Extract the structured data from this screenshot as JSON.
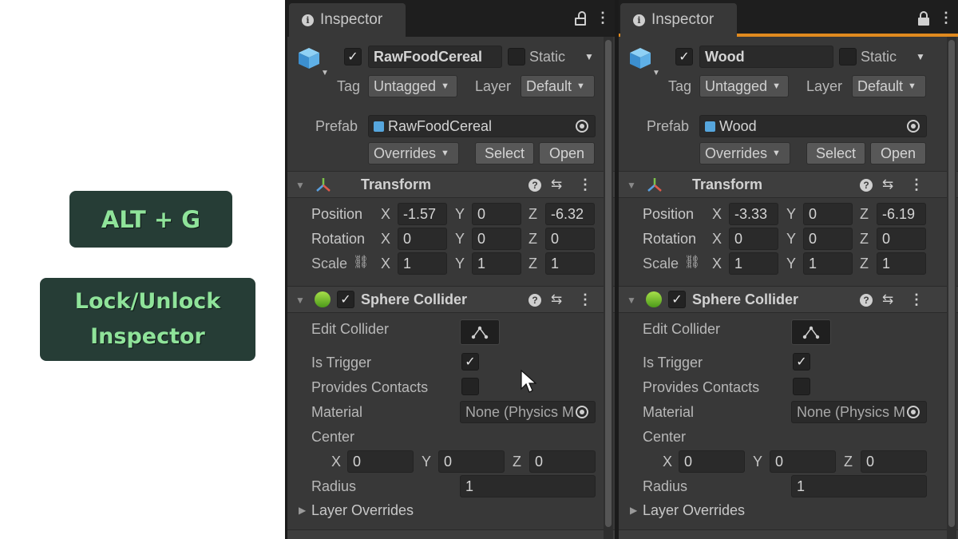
{
  "overlay": {
    "shortcut": "ALT + G",
    "description_line1": "Lock/Unlock",
    "description_line2": "Inspector"
  },
  "colors": {
    "badge_bg": "#263d36",
    "badge_text": "#8fe39a",
    "panel_bg": "#383838",
    "active_tab_accent": "#e08a1f"
  },
  "panels": [
    {
      "tab_label": "Inspector",
      "locked": false,
      "object_name": "RawFoodCereal",
      "enabled": true,
      "static_label": "Static",
      "tag_label": "Tag",
      "tag_value": "Untagged",
      "layer_label": "Layer",
      "layer_value": "Default",
      "prefab_label": "Prefab",
      "prefab_value": "RawFoodCereal",
      "overrides_label": "Overrides",
      "select_label": "Select",
      "open_label": "Open",
      "transform": {
        "title": "Transform",
        "position_label": "Position",
        "position": {
          "x": "-1.57",
          "y": "0",
          "z": "-6.32"
        },
        "rotation_label": "Rotation",
        "rotation": {
          "x": "0",
          "y": "0",
          "z": "0"
        },
        "scale_label": "Scale",
        "scale": {
          "x": "1",
          "y": "1",
          "z": "1"
        }
      },
      "sphere_collider": {
        "title": "Sphere Collider",
        "enabled": true,
        "edit_collider_label": "Edit Collider",
        "is_trigger_label": "Is Trigger",
        "is_trigger": true,
        "provides_contacts_label": "Provides Contacts",
        "provides_contacts": false,
        "material_label": "Material",
        "material_value": "None (Physics M",
        "center_label": "Center",
        "center": {
          "x": "0",
          "y": "0",
          "z": "0"
        },
        "radius_label": "Radius",
        "radius": "1",
        "layer_overrides_label": "Layer Overrides"
      }
    },
    {
      "tab_label": "Inspector",
      "locked": true,
      "object_name": "Wood",
      "enabled": true,
      "static_label": "Static",
      "tag_label": "Tag",
      "tag_value": "Untagged",
      "layer_label": "Layer",
      "layer_value": "Default",
      "prefab_label": "Prefab",
      "prefab_value": "Wood",
      "overrides_label": "Overrides",
      "select_label": "Select",
      "open_label": "Open",
      "transform": {
        "title": "Transform",
        "position_label": "Position",
        "position": {
          "x": "-3.33",
          "y": "0",
          "z": "-6.19"
        },
        "rotation_label": "Rotation",
        "rotation": {
          "x": "0",
          "y": "0",
          "z": "0"
        },
        "scale_label": "Scale",
        "scale": {
          "x": "1",
          "y": "1",
          "z": "1"
        }
      },
      "sphere_collider": {
        "title": "Sphere Collider",
        "enabled": true,
        "edit_collider_label": "Edit Collider",
        "is_trigger_label": "Is Trigger",
        "is_trigger": true,
        "provides_contacts_label": "Provides Contacts",
        "provides_contacts": false,
        "material_label": "Material",
        "material_value": "None (Physics M",
        "center_label": "Center",
        "center": {
          "x": "0",
          "y": "0",
          "z": "0"
        },
        "radius_label": "Radius",
        "radius": "1",
        "layer_overrides_label": "Layer Overrides"
      }
    }
  ]
}
